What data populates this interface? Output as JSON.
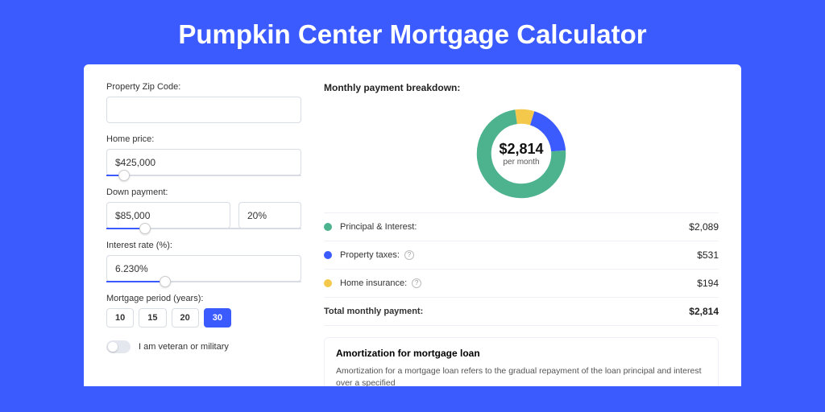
{
  "title": "Pumpkin Center Mortgage Calculator",
  "form": {
    "zip_label": "Property Zip Code:",
    "zip_value": "",
    "home_price_label": "Home price:",
    "home_price_value": "$425,000",
    "home_price_slider_pct": 9,
    "down_payment_label": "Down payment:",
    "down_payment_value": "$85,000",
    "down_payment_pct_value": "20%",
    "down_payment_slider_pct": 20,
    "interest_label": "Interest rate (%):",
    "interest_value": "6.230%",
    "interest_slider_pct": 30,
    "period_label": "Mortgage period (years):",
    "period_options": [
      "10",
      "15",
      "20",
      "30"
    ],
    "period_selected_index": 3,
    "veteran_label": "I am veteran or military"
  },
  "breakdown": {
    "title": "Monthly payment breakdown:",
    "total": "$2,814",
    "per_month": "per month",
    "items": [
      {
        "label": "Principal & Interest:",
        "value": "$2,089",
        "color": "#4db38f",
        "has_help": false,
        "pct": 74
      },
      {
        "label": "Property taxes:",
        "value": "$531",
        "color": "#3b5bff",
        "has_help": true,
        "pct": 19
      },
      {
        "label": "Home insurance:",
        "value": "$194",
        "color": "#f4c94b",
        "has_help": true,
        "pct": 7
      }
    ],
    "total_label": "Total monthly payment:",
    "total_value": "$2,814"
  },
  "amort": {
    "title": "Amortization for mortgage loan",
    "text": "Amortization for a mortgage loan refers to the gradual repayment of the loan principal and interest over a specified"
  },
  "chart_data": {
    "type": "pie",
    "title": "Monthly payment breakdown",
    "categories": [
      "Principal & Interest",
      "Property taxes",
      "Home insurance"
    ],
    "values": [
      2089,
      531,
      194
    ],
    "colors": [
      "#4db38f",
      "#3b5bff",
      "#f4c94b"
    ],
    "center_label": "$2,814 per month"
  }
}
